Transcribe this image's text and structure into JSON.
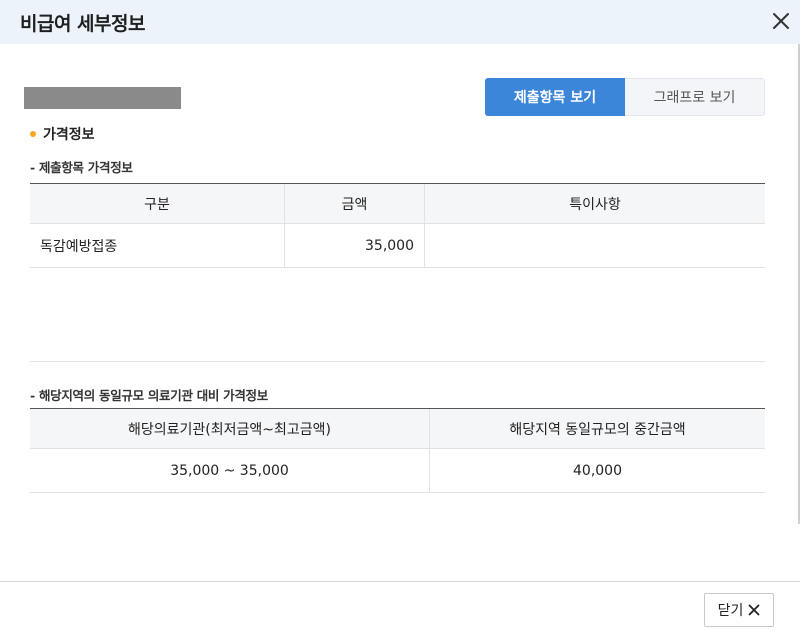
{
  "modal": {
    "title": "비급여 세부정보"
  },
  "view_toggle": {
    "submitted_items_label": "제출항목 보기",
    "graph_label": "그래프로 보기"
  },
  "price_section": {
    "heading": "가격정보",
    "submitted_subheading": "- 제출항목 가격정보",
    "submitted_table": {
      "headers": [
        "구분",
        "금액",
        "특이사항"
      ],
      "rows": [
        [
          "독감예방접종",
          "35,000",
          ""
        ]
      ]
    },
    "comparison_subheading": "- 해당지역의 동일규모 의료기관 대비 가격정보",
    "comparison_table": {
      "headers": [
        "해당의료기관(최저금액~최고금액)",
        "해당지역 동일규모의 중간금액"
      ],
      "rows": [
        [
          "35,000 ~ 35,000",
          "40,000"
        ]
      ]
    }
  },
  "footer": {
    "close_label": "닫기"
  },
  "colors": {
    "header_bg": "#edf3fb",
    "accent_blue": "#3b86d8",
    "bullet_orange": "#f5a623"
  }
}
